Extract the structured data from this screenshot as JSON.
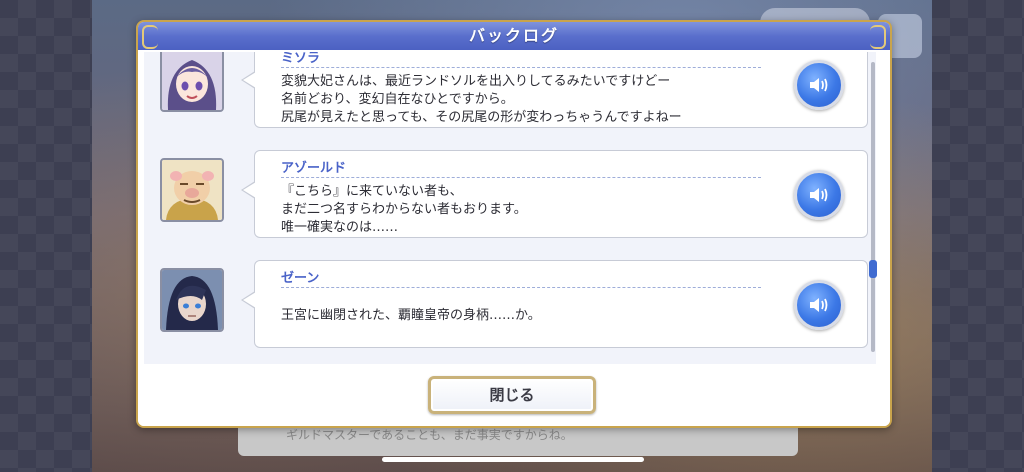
{
  "backlog": {
    "title": "バックログ",
    "entries": [
      {
        "speaker": "ミソラ",
        "text": "変貌大妃さんは、最近ランドソルを出入りしてるみたいですけどー\n名前どおり、変幻自在なひとですから。\n尻尾が見えたと思っても、その尻尾の形が変わっちゃうんですよねー"
      },
      {
        "speaker": "アゾールド",
        "text": "『こちら』に来ていない者も、\nまだ二つ名すらわからない者もおります。\n唯一確実なのは……"
      },
      {
        "speaker": "ゼーン",
        "text": "王宮に幽閉された、覇瞳皇帝の身柄……か。"
      }
    ],
    "close_label": "閉じる"
  },
  "background": {
    "dialog_text": "ギルドマスターであることも、まだ事実ですからね。"
  },
  "colors": {
    "header_blue": "#5a6fcc",
    "speaker_blue": "#4a63c8",
    "voice_button": "#3c78e6",
    "frame_gold": "#c9a44c"
  },
  "icons": {
    "voice": "speaker-volume-icon",
    "menu": "hamburger-menu-icon"
  }
}
